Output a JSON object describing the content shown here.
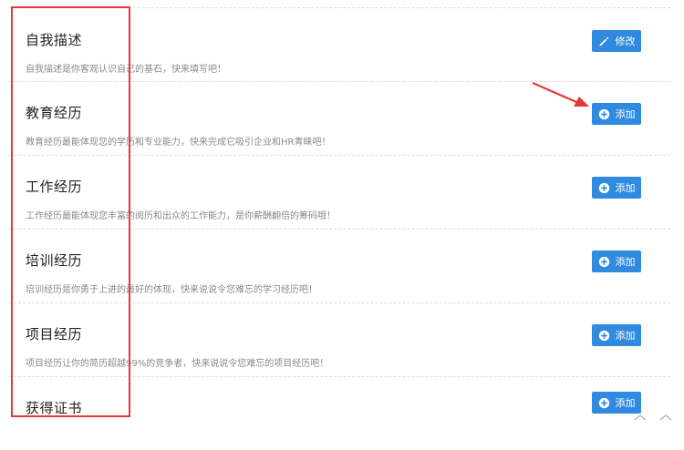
{
  "sections": [
    {
      "title": "自我描述",
      "desc": "自我描述是你客观认识自己的基石，快来填写吧！",
      "button": "修改",
      "icon": "pencil-icon"
    },
    {
      "title": "教育经历",
      "desc": "教育经历最能体现您的学历和专业能力，快来完成它吸引企业和HR青睐吧！",
      "button": "添加",
      "icon": "plus-circle-icon"
    },
    {
      "title": "工作经历",
      "desc": "工作经历最能体现您丰富的阅历和出众的工作能力，是你薪酬翻倍的筹码哦！",
      "button": "添加",
      "icon": "plus-circle-icon"
    },
    {
      "title": "培训经历",
      "desc": "培训经历是你勇于上进的最好的体现，快来说说令您难忘的学习经历吧！",
      "button": "添加",
      "icon": "plus-circle-icon"
    },
    {
      "title": "项目经历",
      "desc": "项目经历让你的简历超越99%的竞争者，快来说说令您难忘的项目经历吧！",
      "button": "添加",
      "icon": "plus-circle-icon"
    },
    {
      "title": "获得证书",
      "desc": "",
      "button": "添加",
      "icon": "plus-circle-icon"
    }
  ],
  "colors": {
    "button": "#2f8ae0",
    "highlight": "#e53935"
  }
}
